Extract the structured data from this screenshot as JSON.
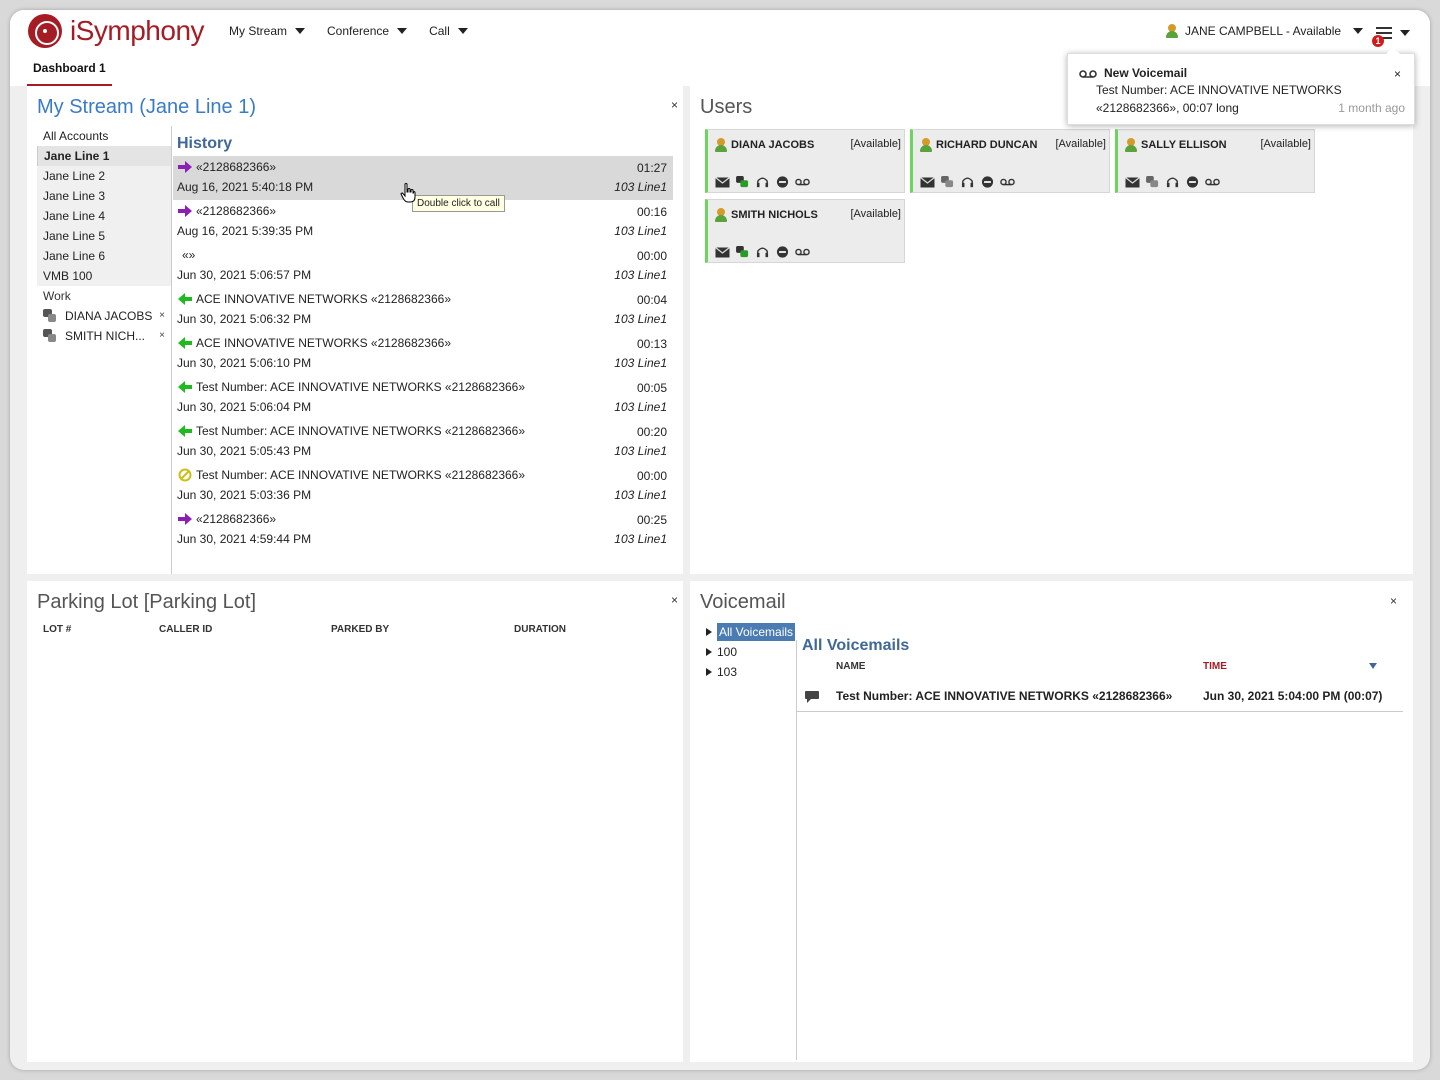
{
  "app": {
    "logo_text": "iSymphony",
    "menu": [
      "My Stream",
      "Conference",
      "Call"
    ],
    "user_status": "JANE CAMPBELL - Available",
    "notification_count": "1"
  },
  "tabs": [
    "Dashboard 1"
  ],
  "notification": {
    "title": "New Voicemail",
    "line1": "Test Number: ACE INNOVATIVE NETWORKS",
    "line2": "«2128682366», 00:07 long",
    "time": "1 month ago",
    "close": "×"
  },
  "stream": {
    "title": "My Stream (Jane Line 1)",
    "close": "×",
    "accounts": [
      "All Accounts",
      "Jane Line 1",
      "Jane Line 2",
      "Jane Line 3",
      "Jane Line 4",
      "Jane Line 5",
      "Jane Line 6",
      "VMB 100"
    ],
    "selected_account": "Jane Line 1",
    "work_label": "Work",
    "work_items": [
      "DIANA JACOBS",
      "SMITH NICH..."
    ],
    "history_title": "History",
    "tooltip": "Double click to call",
    "history": [
      {
        "type": "outgoing",
        "name": "«2128682366»",
        "date": "Aug 16, 2021 5:40:18 PM",
        "duration": "01:27",
        "line": "103 Line1"
      },
      {
        "type": "outgoing",
        "name": "«2128682366»",
        "date": "Aug 16, 2021 5:39:35 PM",
        "duration": "00:16",
        "line": "103 Line1"
      },
      {
        "type": "none",
        "name": "«»",
        "date": "Jun 30, 2021 5:06:57 PM",
        "duration": "00:00",
        "line": "103 Line1"
      },
      {
        "type": "incoming",
        "name": "ACE INNOVATIVE NETWORKS «2128682366»",
        "date": "Jun 30, 2021 5:06:32 PM",
        "duration": "00:04",
        "line": "103 Line1"
      },
      {
        "type": "incoming",
        "name": "ACE INNOVATIVE NETWORKS «2128682366»",
        "date": "Jun 30, 2021 5:06:10 PM",
        "duration": "00:13",
        "line": "103 Line1"
      },
      {
        "type": "incoming",
        "name": "Test Number: ACE INNOVATIVE NETWORKS «2128682366»",
        "date": "Jun 30, 2021 5:06:04 PM",
        "duration": "00:05",
        "line": "103 Line1"
      },
      {
        "type": "incoming",
        "name": "Test Number: ACE INNOVATIVE NETWORKS «2128682366»",
        "date": "Jun 30, 2021 5:05:43 PM",
        "duration": "00:20",
        "line": "103 Line1"
      },
      {
        "type": "missed",
        "name": "Test Number: ACE INNOVATIVE NETWORKS «2128682366»",
        "date": "Jun 30, 2021 5:03:36 PM",
        "duration": "00:00",
        "line": "103 Line1"
      },
      {
        "type": "outgoing",
        "name": "«2128682366»",
        "date": "Jun 30, 2021 4:59:44 PM",
        "duration": "00:25",
        "line": "103 Line1"
      }
    ]
  },
  "users": {
    "title": "Users",
    "cards": [
      {
        "name": "DIANA JACOBS",
        "status": "[Available]"
      },
      {
        "name": "RICHARD DUNCAN",
        "status": "[Available]"
      },
      {
        "name": "SALLY ELLISON",
        "status": "[Available]"
      },
      {
        "name": "SMITH NICHOLS",
        "status": "[Available]"
      }
    ]
  },
  "parking": {
    "title": "Parking Lot [Parking Lot]",
    "close": "×",
    "columns": [
      "LOT #",
      "CALLER ID",
      "PARKED BY",
      "DURATION"
    ]
  },
  "voicemail": {
    "title": "Voicemail",
    "close": "×",
    "tree": [
      "All Voicemails",
      "100",
      "103"
    ],
    "list_title": "All Voicemails",
    "col_name": "NAME",
    "col_time": "TIME",
    "rows": [
      {
        "name": "Test Number: ACE INNOVATIVE NETWORKS «2128682366»",
        "time": "Jun 30, 2021 5:04:00 PM (00:07)"
      }
    ]
  },
  "colors": {
    "brand": "#a51c24",
    "link_blue": "#3a7bc8",
    "outgoing": "#8b1fb5",
    "incoming": "#1fba1f",
    "missed": "#c9c01a",
    "available": "#6fd35f"
  }
}
